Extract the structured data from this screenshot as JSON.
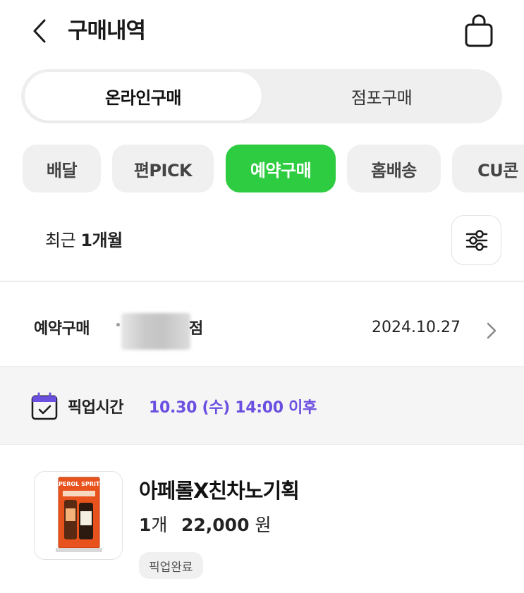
{
  "header": {
    "title": "구매내역",
    "back_icon": "chevron-left-icon",
    "bag_icon": "shopping-bag-icon"
  },
  "segments": [
    {
      "label": "온라인구매",
      "active": true
    },
    {
      "label": "점포구매",
      "active": false
    }
  ],
  "chips": [
    {
      "label": "배달",
      "active": false
    },
    {
      "label": "편PICK",
      "active": false
    },
    {
      "label": "예약구매",
      "active": true
    },
    {
      "label": "홈배송",
      "active": false
    },
    {
      "label": "CU콘",
      "active": false
    }
  ],
  "filter": {
    "period_prefix": "최근",
    "period_value": "1개월",
    "icon": "sliders-icon"
  },
  "order": {
    "type": "예약구매",
    "store_suffix": "점",
    "date": "2024.10.27",
    "chevron_icon": "chevron-right-icon"
  },
  "pickup": {
    "icon": "calendar-check-icon",
    "label": "픽업시간",
    "time": "10.30 (수) 14:00 이후"
  },
  "product": {
    "name": "아페롤X친차노기획",
    "qty_num": "1",
    "qty_unit": "개",
    "price_num": "22,000",
    "price_unit": "원",
    "status": "픽업완료",
    "package_text": "APEROL SPRITZ"
  },
  "colors": {
    "accent_green": "#2ecc40",
    "pickup_purple": "#6b4fe0",
    "chip_bg": "#f0f0f0",
    "product_orange": "#e8531d"
  }
}
